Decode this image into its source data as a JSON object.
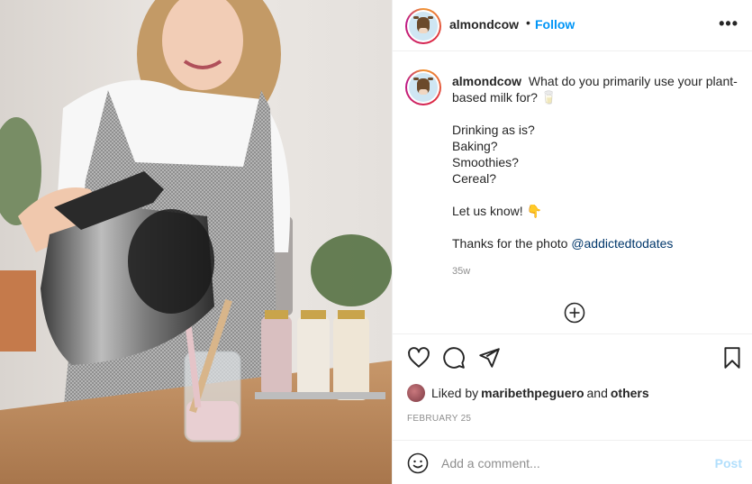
{
  "header": {
    "username": "almondcow",
    "separator": "•",
    "follow_label": "Follow",
    "more_label": "•••"
  },
  "caption": {
    "username": "almondcow",
    "line1": "What do you primarily use your plant-based milk for? 🥛",
    "options": [
      "Drinking as is?",
      "Baking?",
      "Smoothies?",
      "Cereal?"
    ],
    "cta": "Let us know! 👇",
    "thanks_prefix": "Thanks for the photo ",
    "mention": "@addictedtodates",
    "time": "35w"
  },
  "likes": {
    "prefix": "Liked by ",
    "user": "maribethpeguero",
    "middle": " and ",
    "others": "others"
  },
  "date": "FEBRUARY 25",
  "comment": {
    "placeholder": "Add a comment...",
    "post_label": "Post"
  },
  "icons": {
    "like": "heart-icon",
    "comment": "comment-bubble-icon",
    "share": "paper-plane-icon",
    "save": "bookmark-icon",
    "add": "add-circle-icon",
    "emoji": "smiley-icon"
  },
  "colors": {
    "follow": "#0095f6",
    "mention": "#00376b",
    "muted": "#8e8e8e",
    "post_disabled": "#b2dffc"
  }
}
